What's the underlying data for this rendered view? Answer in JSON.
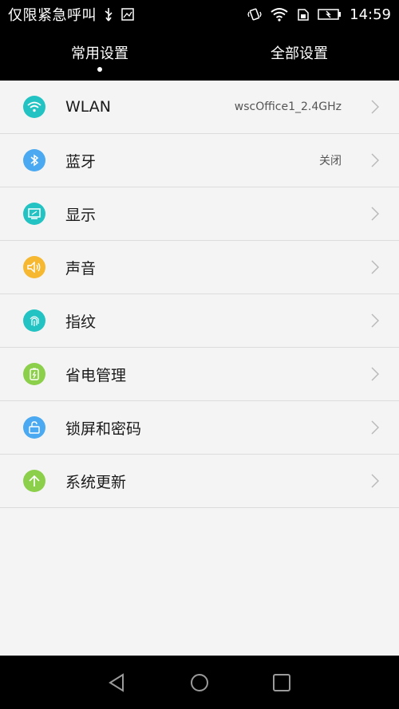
{
  "status_bar": {
    "title": "仅限紧急呼叫",
    "time": "14:59",
    "icons": [
      "usb-icon",
      "image-icon",
      "vibrate-icon",
      "wifi-icon",
      "sim-icon",
      "battery-icon"
    ]
  },
  "tabs": [
    {
      "label": "常用设置",
      "active": true
    },
    {
      "label": "全部设置",
      "active": false
    }
  ],
  "settings": [
    {
      "label": "WLAN",
      "value": "wscOffice1_2.4GHz",
      "icon": "wifi-icon",
      "color": "#23c3c3"
    },
    {
      "label": "蓝牙",
      "value": "关闭",
      "icon": "bluetooth-icon",
      "color": "#4aa9f0"
    },
    {
      "label": "显示",
      "value": "",
      "icon": "display-icon",
      "color": "#23c3c3"
    },
    {
      "label": "声音",
      "value": "",
      "icon": "speaker-icon",
      "color": "#f5b830"
    },
    {
      "label": "指纹",
      "value": "",
      "icon": "fingerprint-icon",
      "color": "#23c3c3"
    },
    {
      "label": "省电管理",
      "value": "",
      "icon": "battery-saver-icon",
      "color": "#8ccf4a"
    },
    {
      "label": "锁屏和密码",
      "value": "",
      "icon": "unlock-icon",
      "color": "#4aa9f0"
    },
    {
      "label": "系统更新",
      "value": "",
      "icon": "update-arrow-icon",
      "color": "#8ccf4a"
    }
  ],
  "nav_bar": {
    "buttons": [
      "back-icon",
      "home-icon",
      "recents-icon"
    ]
  },
  "colors": {
    "bar_background": "#000000",
    "list_background": "#f4f4f4",
    "divider": "#dcdcdc"
  }
}
